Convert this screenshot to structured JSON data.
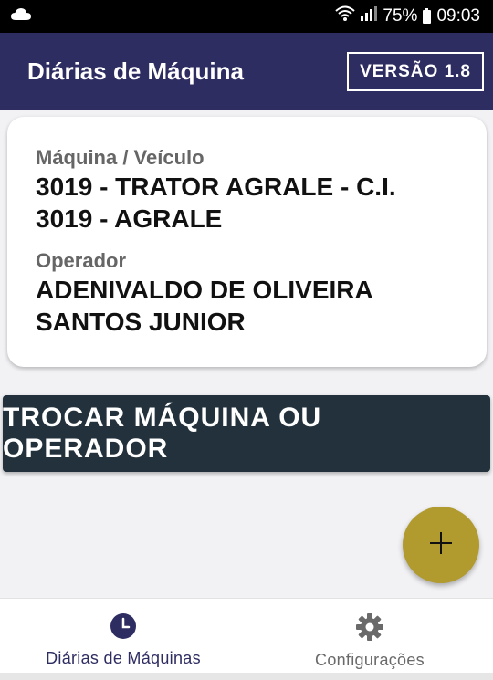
{
  "status_bar": {
    "battery": "75%",
    "time": "09:03",
    "icons": [
      "cloud-icon",
      "wifi-icon",
      "signal-icon",
      "battery-icon"
    ]
  },
  "app_bar": {
    "title": "Diárias de Máquina",
    "version_label": "VERSÃO 1.8",
    "color": "#2e2d62"
  },
  "card": {
    "machine_label": "Máquina / Veículo",
    "machine_value": "3019 - TRATOR AGRALE - C.I. 3019 - AGRALE",
    "operator_label": "Operador",
    "operator_value": "ADENIVALDO DE OLIVEIRA SANTOS JUNIOR"
  },
  "swap_button": {
    "label": "TROCAR MÁQUINA OU OPERADOR",
    "color": "#22313b"
  },
  "fab": {
    "icon": "plus-icon",
    "color": "#b19a2e"
  },
  "bottom_nav": {
    "items": [
      {
        "label": "Diárias de Máquinas",
        "icon": "clock-icon",
        "active": true
      },
      {
        "label": "Configurações",
        "icon": "gear-icon",
        "active": false
      }
    ]
  }
}
